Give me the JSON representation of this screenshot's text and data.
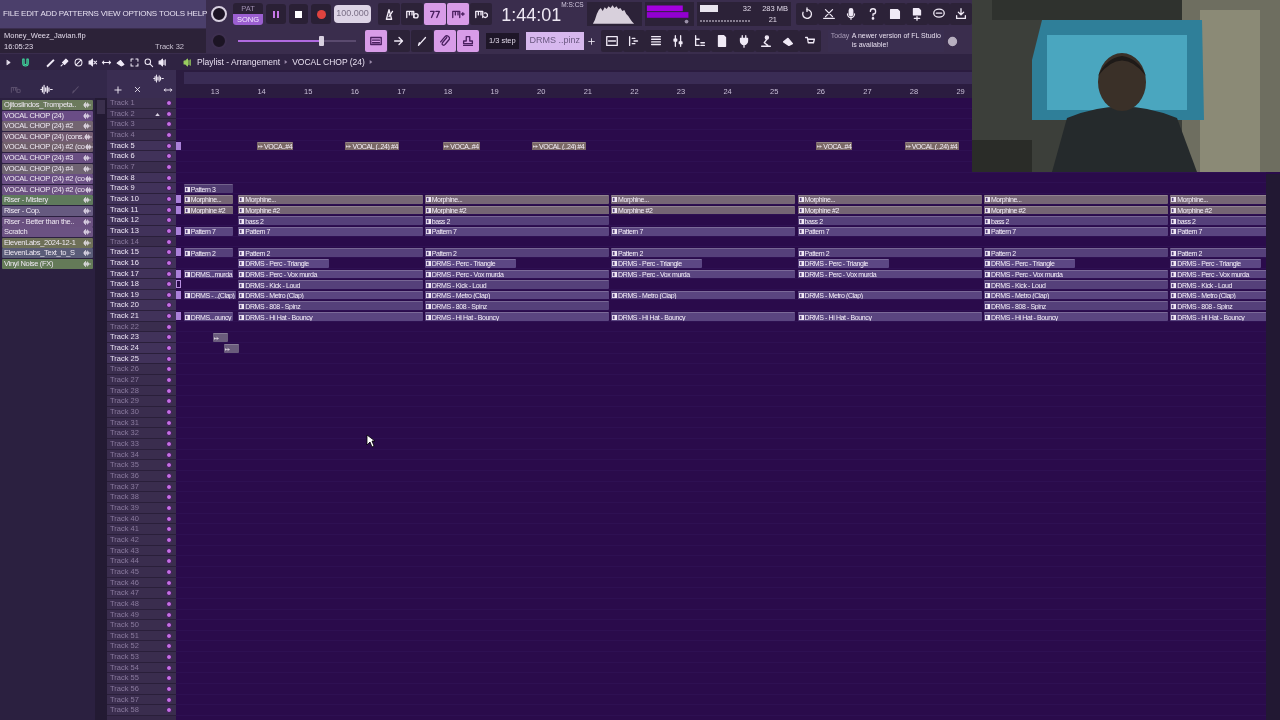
{
  "menu": [
    "FILE",
    "EDIT",
    "ADD",
    "PATTERNS",
    "VIEW",
    "OPTIONS",
    "TOOLS",
    "HELP"
  ],
  "project": {
    "file": "Money_Weez_Javian.flp",
    "time": "16:05:23",
    "hint": "Track 32"
  },
  "transport": {
    "modes": [
      {
        "label": "PAT",
        "selected": false
      },
      {
        "label": "SONG",
        "selected": true
      }
    ],
    "tempo": "100.000"
  },
  "master_volume": {
    "level": 0.7
  },
  "toolbar_upper": [
    {
      "on": false
    },
    {
      "on": false
    },
    {
      "on": true
    },
    {
      "on": true
    },
    {
      "on": false
    }
  ],
  "toolbar_lower": [
    {
      "on": true
    },
    {
      "on": false
    },
    {
      "on": false
    },
    {
      "on": true
    },
    {
      "on": true
    }
  ],
  "clock": {
    "unit": "M:S:CS",
    "value": "1:44:01"
  },
  "monitor": {
    "cpu": "32",
    "memory": "283 MB",
    "polyphony": "21"
  },
  "snap": "1/3 step",
  "pattern": "DRMS ..pinz",
  "news": {
    "day": "Today",
    "text": "A newer version of FL Studio is available!"
  },
  "playlist": {
    "title": "Playlist - Arrangement",
    "crumb": "VOCAL CHOP (24)",
    "bars": [
      "13",
      "14",
      "15",
      "16",
      "17",
      "18",
      "19",
      "20",
      "21",
      "22",
      "23",
      "24",
      "25",
      "26",
      "27",
      "28",
      "29"
    ]
  },
  "channels": [
    {
      "name": "Ojitoslindos_Trompeta..",
      "color": "#6b7a5c"
    },
    {
      "name": "VOCAL CHOP (24)",
      "color": "#6a4d86"
    },
    {
      "name": "VOCAL CHOP (24) #2",
      "color": "#736571"
    },
    {
      "name": "VOCAL CHOP (24) (cons.",
      "color": "#735c72"
    },
    {
      "name": "VOCAL CHOP (24) #2 (co",
      "color": "#71606c"
    },
    {
      "name": "VOCAL CHOP (24) #3",
      "color": "#6a4f83"
    },
    {
      "name": "VOCAL CHOP (24) #4",
      "color": "#6f6472"
    },
    {
      "name": "VOCAL CHOP (24) #2 (co",
      "color": "#6a4f84"
    },
    {
      "name": "VOCAL CHOP (24) #2 (co",
      "color": "#6c5282"
    },
    {
      "name": "Riser - Mistery",
      "color": "#5f7a5c"
    },
    {
      "name": "Riser - Cop.",
      "color": "#665a80"
    },
    {
      "name": "Riser - Better than the..",
      "color": "#6a5080"
    },
    {
      "name": "Scratch",
      "color": "#6b5282"
    },
    {
      "name": "ElevenLabs_2024-12-1",
      "color": "#6e7058"
    },
    {
      "name": "ElevenLabs_Text_to_S",
      "color": "#5a5c78"
    },
    {
      "name": "Vinyl Noise (FX)",
      "color": "#647a58"
    }
  ],
  "tracks": [
    {
      "label": "Track 1",
      "dimmed": true
    },
    {
      "label": "Track 2",
      "dimmed": true,
      "group_toggle": true
    },
    {
      "label": "Track 3",
      "dimmed": true
    },
    {
      "label": "Track 4",
      "dimmed": true
    },
    {
      "label": "Track 5",
      "dimmed": false,
      "edge_clip": {
        "kind": "filled"
      },
      "color": "#7a6866",
      "clips": [
        {
          "kind": "audio",
          "label": "VOCA..#4"
        },
        {
          "kind": "audio",
          "label": "VOCAL (..24) #4"
        },
        {
          "kind": "audio",
          "label": "VOCA..#4"
        },
        {
          "kind": "audio",
          "label": "VOCAL (..24) #4"
        },
        {
          "kind": "audio",
          "label": "VOCA..#4"
        },
        {
          "kind": "audio",
          "label": "VOCAL (..24) #4"
        }
      ]
    },
    {
      "label": "Track 6",
      "dimmed": false
    },
    {
      "label": "Track 7",
      "dimmed": true
    },
    {
      "label": "Track 8",
      "dimmed": false
    },
    {
      "label": "Track 9",
      "dimmed": false,
      "color": "#4f3b70",
      "clips": [
        {
          "kind": "pattern",
          "label": "Pattern 3"
        }
      ]
    },
    {
      "label": "Track 10",
      "dimmed": false,
      "edge_clip": {
        "kind": "filled"
      },
      "color": "#766675",
      "clips": [
        {
          "kind": "pattern",
          "label": "Morphine..."
        },
        {
          "kind": "pattern",
          "label": "Morphine..."
        },
        {
          "kind": "pattern",
          "label": "Morphine..."
        },
        {
          "kind": "pattern",
          "label": "Morphine..."
        },
        {
          "kind": "pattern",
          "label": "Morphine..."
        },
        {
          "kind": "pattern",
          "label": "Morphine..."
        },
        {
          "kind": "pattern",
          "label": "Morphine..."
        }
      ]
    },
    {
      "label": "Track 11",
      "dimmed": false,
      "edge_clip": {
        "kind": "filled"
      },
      "color": "#756574",
      "clips": [
        {
          "kind": "pattern",
          "label": "Morphine #2"
        },
        {
          "kind": "pattern",
          "label": "Morphine #2"
        },
        {
          "kind": "pattern",
          "label": "Morphine #2"
        },
        {
          "kind": "pattern",
          "label": "Morphine #2"
        },
        {
          "kind": "pattern",
          "label": "Morphine #2"
        },
        {
          "kind": "pattern",
          "label": "Morphine #2"
        },
        {
          "kind": "pattern",
          "label": "Morphine #2"
        }
      ]
    },
    {
      "label": "Track 12",
      "dimmed": false,
      "color": "#55407a",
      "clips": [
        {
          "kind": "pattern",
          "label": "bass 2"
        },
        {
          "kind": "pattern",
          "label": "bass 2"
        },
        {
          "kind": "pattern",
          "label": "bass 2"
        },
        {
          "kind": "pattern",
          "label": "bass 2"
        },
        {
          "kind": "pattern",
          "label": "bass 2"
        }
      ]
    },
    {
      "label": "Track 13",
      "dimmed": false,
      "edge_clip": {
        "kind": "filled"
      },
      "color": "#5a4580",
      "clips": [
        {
          "kind": "pattern",
          "label": "Pattern 7"
        },
        {
          "kind": "pattern",
          "label": "Pattern 7"
        },
        {
          "kind": "pattern",
          "label": "Pattern 7"
        },
        {
          "kind": "pattern",
          "label": "Pattern 7"
        },
        {
          "kind": "pattern",
          "label": "Pattern 7"
        },
        {
          "kind": "pattern",
          "label": "Pattern 7"
        },
        {
          "kind": "pattern",
          "label": "Pattern 7"
        }
      ]
    },
    {
      "label": "Track 14",
      "dimmed": true
    },
    {
      "label": "Track 15",
      "dimmed": false,
      "edge_clip": {
        "kind": "filled"
      },
      "color": "#55407a",
      "clips": [
        {
          "kind": "pattern",
          "label": "Pattern 2"
        },
        {
          "kind": "pattern",
          "label": "Pattern 2"
        },
        {
          "kind": "pattern",
          "label": "Pattern 2"
        },
        {
          "kind": "pattern",
          "label": "Pattern 2"
        },
        {
          "kind": "pattern",
          "label": "Pattern 2"
        },
        {
          "kind": "pattern",
          "label": "Pattern 2"
        },
        {
          "kind": "pattern",
          "label": "Pattern 2"
        }
      ]
    },
    {
      "label": "Track 16",
      "dimmed": false,
      "color": "#5c4784",
      "clips": [
        {
          "kind": "pattern",
          "label": "DRMS - Perc - Triangle"
        },
        {
          "kind": "pattern",
          "label": "DRMS - Perc - Triangle"
        },
        {
          "kind": "pattern",
          "label": "DRMS - Perc - Triangle"
        },
        {
          "kind": "pattern",
          "label": "DRMS - Perc - Triangle"
        },
        {
          "kind": "pattern",
          "label": "DRMS - Perc - Triangle"
        },
        {
          "kind": "pattern",
          "label": "DRMS - Perc - Triangle"
        }
      ]
    },
    {
      "label": "Track 17",
      "dimmed": false,
      "edge_clip": {
        "kind": "filled"
      },
      "color": "#5a4580",
      "clips": [
        {
          "kind": "pattern",
          "label": "DRMS...murda"
        },
        {
          "kind": "pattern",
          "label": "DRMS - Perc - Vox murda"
        },
        {
          "kind": "pattern",
          "label": "DRMS - Perc - Vox murda"
        },
        {
          "kind": "pattern",
          "label": "DRMS - Perc - Vox murda"
        },
        {
          "kind": "pattern",
          "label": "DRMS - Perc - Vox murda"
        },
        {
          "kind": "pattern",
          "label": "DRMS - Perc - Vox murda"
        },
        {
          "kind": "pattern",
          "label": "DRMS - Perc - Vox murda"
        }
      ]
    },
    {
      "label": "Track 18",
      "dimmed": false,
      "edge_clip": {
        "kind": "outline"
      },
      "color": "#55407a",
      "clips": [
        {
          "kind": "pattern",
          "label": "DRMS - Kick - Loud"
        },
        {
          "kind": "pattern",
          "label": "DRMS - Kick - Loud"
        },
        {
          "kind": "pattern",
          "label": "DRMS - Kick - Loud"
        },
        {
          "kind": "pattern",
          "label": "DRMS - Kick - Loud"
        }
      ]
    },
    {
      "label": "Track 19",
      "dimmed": false,
      "edge_clip": {
        "kind": "filled"
      },
      "color": "#5a4580",
      "clips": [
        {
          "kind": "pattern",
          "label": "DRMS - ..(Clap)"
        },
        {
          "kind": "pattern",
          "label": "DRMS - Metro (Clap)"
        },
        {
          "kind": "pattern",
          "label": "DRMS - Metro (Clap)"
        },
        {
          "kind": "pattern",
          "label": "DRMS - Metro (Clap)"
        },
        {
          "kind": "pattern",
          "label": "DRMS - Metro (Clap)"
        },
        {
          "kind": "pattern",
          "label": "DRMS - Metro (Clap)"
        },
        {
          "kind": "pattern",
          "label": "DRMS - Metro (Clap)"
        }
      ]
    },
    {
      "label": "Track 20",
      "dimmed": false,
      "color": "#55407a",
      "clips": [
        {
          "kind": "pattern",
          "label": "DRMS - 808 - Spinz"
        },
        {
          "kind": "pattern",
          "label": "DRMS - 808 - Spinz"
        },
        {
          "kind": "pattern",
          "label": "DRMS - 808 - Spinz"
        },
        {
          "kind": "pattern",
          "label": "DRMS - 808 - Spinz"
        }
      ]
    },
    {
      "label": "Track 21",
      "dimmed": false,
      "edge_clip": {
        "kind": "filled"
      },
      "color": "#5a4580",
      "clips": [
        {
          "kind": "pattern",
          "label": "DRMS...ouncy"
        },
        {
          "kind": "pattern",
          "label": "DRMS - Hi Hat - Bouncy"
        },
        {
          "kind": "pattern",
          "label": "DRMS - Hi Hat - Bouncy"
        },
        {
          "kind": "pattern",
          "label": "DRMS - Hi Hat - Bouncy"
        },
        {
          "kind": "pattern",
          "label": "DRMS - Hi Hat - Bouncy"
        },
        {
          "kind": "pattern",
          "label": "DRMS - Hi Hat - Bouncy"
        },
        {
          "kind": "pattern",
          "label": "DRMS - Hi Hat - Bouncy"
        }
      ]
    },
    {
      "label": "Track 22",
      "dimmed": true
    },
    {
      "label": "Track 23",
      "dimmed": false,
      "color": "#6a5c7c",
      "clips": [
        {
          "kind": "audio"
        }
      ]
    },
    {
      "label": "Track 24",
      "dimmed": false,
      "color": "#6a5c7c",
      "clips": [
        {
          "kind": "audio"
        }
      ]
    },
    {
      "label": "Track 25",
      "dimmed": false
    },
    {
      "label": "Track 26",
      "dimmed": true
    },
    {
      "label": "Track 27",
      "dimmed": true
    },
    {
      "label": "Track 28",
      "dimmed": true
    },
    {
      "label": "Track 29",
      "dimmed": true
    },
    {
      "label": "Track 30",
      "dimmed": true
    },
    {
      "label": "Track 31",
      "dimmed": true
    },
    {
      "label": "Track 32",
      "dimmed": true
    },
    {
      "label": "Track 33",
      "dimmed": true
    },
    {
      "label": "Track 34",
      "dimmed": true
    },
    {
      "label": "Track 35",
      "dimmed": true
    },
    {
      "label": "Track 36",
      "dimmed": true
    },
    {
      "label": "Track 37",
      "dimmed": true
    },
    {
      "label": "Track 38",
      "dimmed": true
    },
    {
      "label": "Track 39",
      "dimmed": true
    },
    {
      "label": "Track 40",
      "dimmed": true
    },
    {
      "label": "Track 41",
      "dimmed": true
    },
    {
      "label": "Track 42",
      "dimmed": true
    },
    {
      "label": "Track 43",
      "dimmed": true
    },
    {
      "label": "Track 44",
      "dimmed": true
    },
    {
      "label": "Track 45",
      "dimmed": true
    },
    {
      "label": "Track 46",
      "dimmed": true
    },
    {
      "label": "Track 47",
      "dimmed": true
    },
    {
      "label": "Track 48",
      "dimmed": true
    },
    {
      "label": "Track 49",
      "dimmed": true
    },
    {
      "label": "Track 50",
      "dimmed": true
    },
    {
      "label": "Track 51",
      "dimmed": true
    },
    {
      "label": "Track 52",
      "dimmed": true
    },
    {
      "label": "Track 53",
      "dimmed": true
    },
    {
      "label": "Track 54",
      "dimmed": true
    },
    {
      "label": "Track 55",
      "dimmed": true
    },
    {
      "label": "Track 56",
      "dimmed": true
    },
    {
      "label": "Track 57",
      "dimmed": true
    },
    {
      "label": "Track 58",
      "dimmed": true
    }
  ]
}
